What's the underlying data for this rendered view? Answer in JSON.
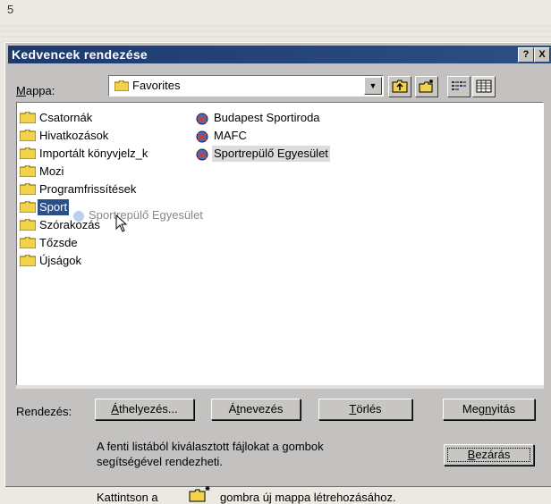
{
  "page": {
    "number": "5"
  },
  "window": {
    "title": "Kedvencek rendezése",
    "help_button": "?",
    "close_button": "X"
  },
  "folder_bar": {
    "label_prefix": "M",
    "label_rest": "appa:",
    "current": "Favorites",
    "icons": [
      "up-one-level-icon",
      "new-folder-icon",
      "list-view-icon",
      "details-view-icon"
    ]
  },
  "list": {
    "folders": [
      "Csatornák",
      "Hivatkozások",
      "Importált könyvjelz_k",
      "Mozi",
      "Programfrissítések",
      "Sport",
      "Szórakozás",
      "Tőzsde",
      "Újságok"
    ],
    "links": [
      "Budapest Sportiroda",
      "MAFC",
      "Sportrepülő Egyesület"
    ],
    "drag_ghost": "Sportrepülő Egyesület"
  },
  "actions": {
    "label": "Rendezés:",
    "move": {
      "u": "Á",
      "rest": "thelyezés..."
    },
    "rename": {
      "pre": "Á",
      "u": "t",
      "rest": "nevezés"
    },
    "delete": {
      "u": "T",
      "rest": "örlés"
    },
    "open": {
      "pre": "Meg",
      "u": "n",
      "rest": "yitás"
    },
    "close": {
      "u": "B",
      "rest": "ezárás"
    }
  },
  "info": {
    "description": "A fenti listából kiválasztott fájlokat a gombok segítségével rendezheti.",
    "hint_before": "Kattintson a",
    "hint_after": "gombra új mappa létrehozásához."
  },
  "colors": {
    "titlebar": "#1d3a6e",
    "face": "#c4c2c0",
    "selection": "#2c4f86"
  }
}
